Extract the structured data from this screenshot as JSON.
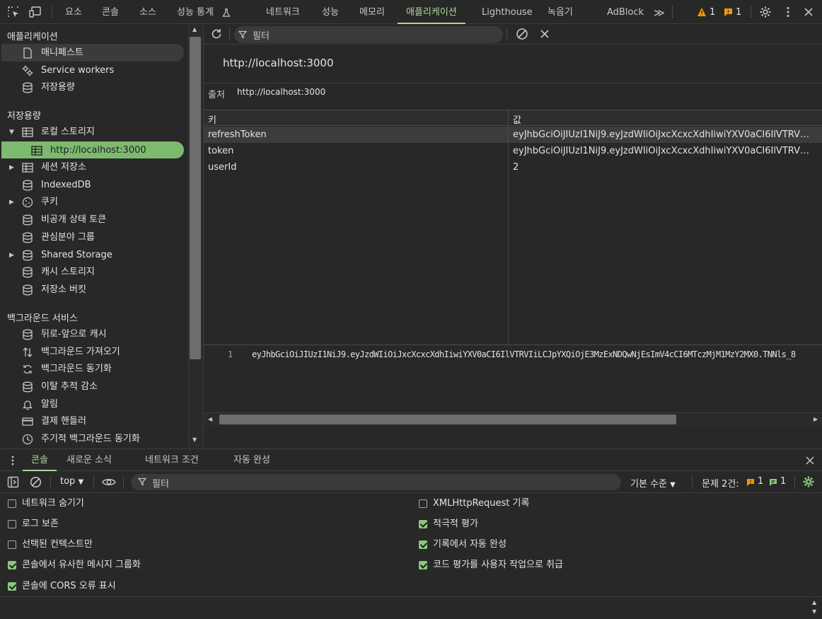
{
  "toolbar": {
    "tabs": [
      "요소",
      "콘솔",
      "소스",
      "성능 통계",
      "네트워크",
      "성능",
      "메모리",
      "애플리케이션",
      "Lighthouse",
      "녹음기",
      "AdBlock"
    ],
    "warnings_count": "1",
    "issues_count": "1"
  },
  "sidebar": {
    "section_app": "애플리케이션",
    "app_items": [
      "매니페스트",
      "Service workers",
      "저장용량"
    ],
    "section_storage": "저장용량",
    "storage_items": [
      "로컬 스토리지",
      "http://localhost:3000",
      "세션 저장소",
      "IndexedDB",
      "쿠키",
      "비공개 상태 토큰",
      "관심분야 그룹",
      "Shared Storage",
      "캐시 스토리지",
      "저장소 버킷"
    ],
    "section_bg": "백그라운드 서비스",
    "bg_items": [
      "뒤로-앞으로 캐시",
      "백그라운드 가져오기",
      "백그라운드 동기화",
      "이탈 추적 감소",
      "알림",
      "결제 핸들러",
      "주기적 백그라운드 동기화"
    ]
  },
  "main": {
    "filter_placeholder": "필터",
    "title": "http://localhost:3000",
    "origin_label": "출처",
    "origin_value": "http://localhost:3000",
    "col_key": "키",
    "col_value": "값",
    "rows": [
      {
        "key": "refreshToken",
        "value": "eyJhbGciOiJIUzI1NiJ9.eyJzdWIiOiJxcXcxcXdhIiwiYXV0aCI6IlVTRVIiLC..."
      },
      {
        "key": "token",
        "value": "eyJhbGciOiJIUzI1NiJ9.eyJzdWIiOiJxcXcxcXdhIiwiYXV0aCI6IlVTRVIiLC..."
      },
      {
        "key": "userId",
        "value": "2"
      }
    ],
    "preview_line_no": "1",
    "preview_text": "eyJhbGciOiJIUzI1NiJ9.eyJzdWIiOiJxcXcxcXdhIiwiYXV0aCI6IlVTRVIiLCJpYXQiOjE3MzExNDQwNjEsImV4cCI6MTczMjM1MzY2MX0.TNNls_8"
  },
  "drawer": {
    "tabs": [
      "콘솔",
      "새로운 소식",
      "네트워크 조건",
      "자동 완성"
    ],
    "context": "top",
    "filter_placeholder": "필터",
    "level": "기본 수준",
    "issues_label": "문제 2건:",
    "issues_warn": "1",
    "issues_info": "1",
    "options_left": [
      {
        "label": "네트워크 숨기기",
        "checked": false
      },
      {
        "label": "로그 보존",
        "checked": false
      },
      {
        "label": "선택된 컨텍스트만",
        "checked": false
      },
      {
        "label": "콘솔에서 유사한 메시지 그룹화",
        "checked": true
      },
      {
        "label": "콘솔에 CORS 오류 표시",
        "checked": true
      }
    ],
    "options_right": [
      {
        "label": "XMLHttpRequest 기록",
        "checked": false
      },
      {
        "label": "적극적 평가",
        "checked": true
      },
      {
        "label": "기록에서 자동 완성",
        "checked": true
      },
      {
        "label": "코드 평가를 사용자 작업으로 취급",
        "checked": true
      }
    ]
  },
  "colors": {
    "accent": "#a8d89a",
    "selected": "#7dba6f",
    "warning": "#f29900",
    "error": "#e46962"
  }
}
